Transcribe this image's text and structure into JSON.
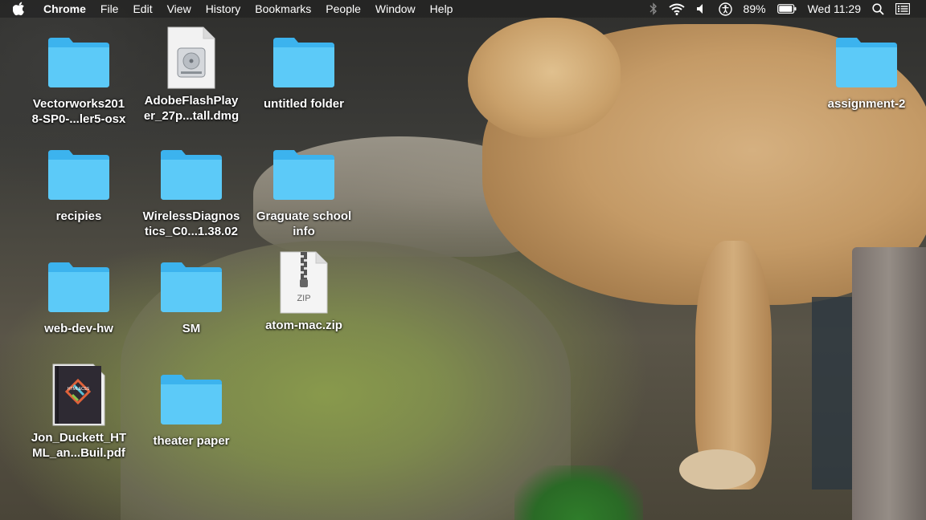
{
  "menubar": {
    "apple_icon": "apple-logo-icon",
    "app_name": "Chrome",
    "menus": [
      "File",
      "Edit",
      "View",
      "History",
      "Bookmarks",
      "People",
      "Window",
      "Help"
    ],
    "status": {
      "bluetooth_icon": "bluetooth-icon",
      "wifi_icon": "wifi-icon",
      "volume_icon": "volume-icon",
      "accessibility_icon": "accessibility-icon",
      "battery_percent": "89%",
      "battery_icon": "battery-icon",
      "clock": "Wed 11:29",
      "spotlight_icon": "search-icon",
      "notification_icon": "notification-center-icon"
    }
  },
  "desktop": {
    "folder_color": "#4fc3f7",
    "icons": [
      {
        "label": "Vectorworks201\n8-SP0-...ler5-osx",
        "kind": "folder"
      },
      {
        "label": "AdobeFlashPlay\ner_27p...tall.dmg",
        "kind": "dmg"
      },
      {
        "label": "untitled folder",
        "kind": "folder"
      },
      {
        "label": "assignment-2",
        "kind": "folder"
      },
      {
        "label": "recipies",
        "kind": "folder"
      },
      {
        "label": "WirelessDiagnos\ntics_C0...1.38.02",
        "kind": "folder"
      },
      {
        "label": "Graguate school\ninfo",
        "kind": "folder"
      },
      {
        "label": "web-dev-hw",
        "kind": "folder"
      },
      {
        "label": "SM",
        "kind": "folder"
      },
      {
        "label": "atom-mac.zip",
        "kind": "zip",
        "badge": "ZIP"
      },
      {
        "label": "Jon_Duckett_HT\nML_an...Buil.pdf",
        "kind": "pdf",
        "cover_text": "HTML&CSS"
      },
      {
        "label": "theater paper",
        "kind": "folder"
      }
    ]
  }
}
